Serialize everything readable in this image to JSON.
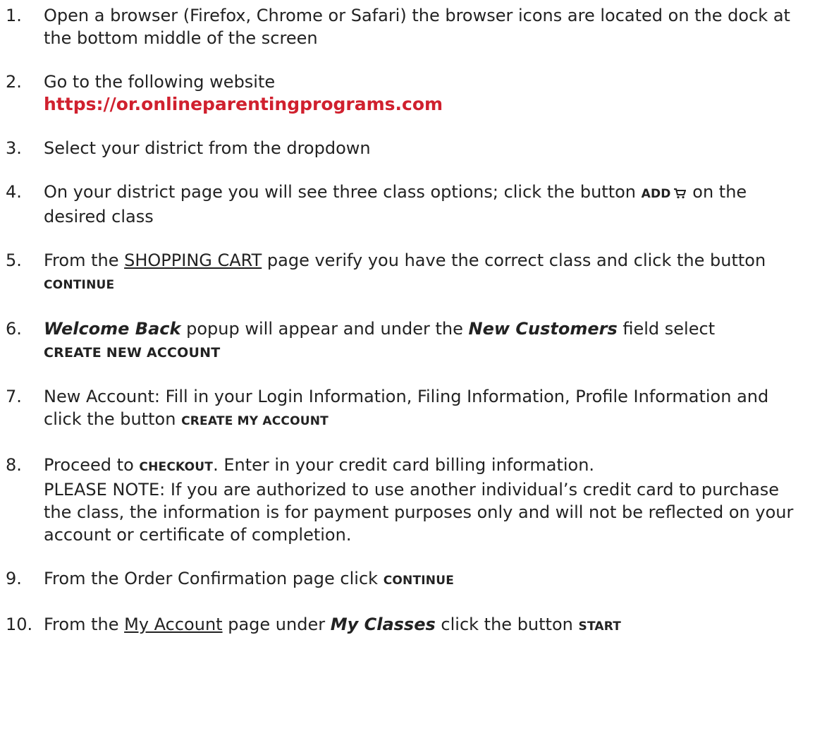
{
  "steps": [
    {
      "num": "1.",
      "text": "Open a browser (Firefox, Chrome or Safari) the browser icons are located on the dock at the bottom middle of the screen"
    },
    {
      "num": "2.",
      "text": "Go to the following website",
      "link": "https://or.onlineparentingprograms.com"
    },
    {
      "num": "3.",
      "text": "Select your district from the dropdown"
    },
    {
      "num": "4.",
      "before": "On your district page you will see three class options; click the button",
      "button": "ADD",
      "icon": "shopping-cart-icon",
      "after": "on the desired class"
    },
    {
      "num": "5.",
      "before": "From the",
      "page": "SHOPPING CART",
      "middle": "page verify you have the correct class and click the button",
      "button": "CONTINUE"
    },
    {
      "num": "6.",
      "popup": "Welcome Back",
      "middle": "popup will appear and under the",
      "field": "New Customers",
      "after": "field select",
      "button": "CREATE NEW ACCOUNT"
    },
    {
      "num": "7.",
      "text": "New Account: Fill in your Login Information, Filing Information, Profile Information and click the button",
      "button": "CREATE MY ACCOUNT"
    },
    {
      "num": "8.",
      "before": "Proceed to",
      "button": "CHECKOUT",
      "after": ". Enter in your credit card billing information.",
      "note": "PLEASE NOTE: If you are authorized to use another individual’s credit card to purchase the class, the information is for payment purposes only and will not be reflected on your account or certificate of completion."
    },
    {
      "num": "9.",
      "text": "From the Order Confirmation page click",
      "button": "CONTINUE"
    },
    {
      "num": "10.",
      "before": "From the",
      "page": "My Account",
      "middle": "page under",
      "section": "My Classes",
      "after": "click the button",
      "button": "START"
    }
  ]
}
